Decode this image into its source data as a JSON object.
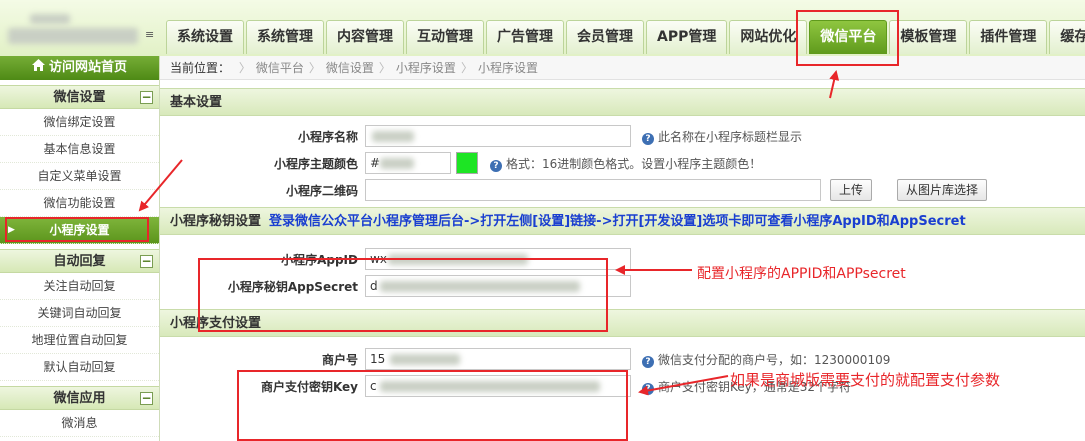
{
  "header": {
    "logo_tail": "≡",
    "tabs": [
      {
        "label": "系统设置",
        "active": false
      },
      {
        "label": "系统管理",
        "active": false
      },
      {
        "label": "内容管理",
        "active": false
      },
      {
        "label": "互动管理",
        "active": false
      },
      {
        "label": "广告管理",
        "active": false
      },
      {
        "label": "会员管理",
        "active": false
      },
      {
        "label": "APP管理",
        "active": false
      },
      {
        "label": "网站优化",
        "active": false
      },
      {
        "label": "微信平台",
        "active": true
      },
      {
        "label": "模板管理",
        "active": false
      },
      {
        "label": "插件管理",
        "active": false
      },
      {
        "label": "缓存",
        "active": false
      }
    ]
  },
  "sidebar": {
    "home": "访问网站首页",
    "groups": [
      {
        "title": "微信设置",
        "toggle": "−",
        "items": [
          "微信绑定设置",
          "基本信息设置",
          "自定义菜单设置",
          "微信功能设置",
          "小程序设置"
        ]
      },
      {
        "title": "自动回复",
        "toggle": "−",
        "items": [
          "关注自动回复",
          "关键词自动回复",
          "地理位置自动回复",
          "默认自动回复"
        ]
      },
      {
        "title": "微信应用",
        "toggle": "−",
        "items": [
          "微消息"
        ]
      }
    ],
    "active_item": "小程序设置"
  },
  "breadcrumb": {
    "label": "当前位置：",
    "items": [
      "微信平台",
      "微信设置",
      "小程序设置",
      "小程序设置"
    ]
  },
  "form": {
    "basic": {
      "title": "基本设置",
      "name_label": "小程序名称",
      "name_hint": "此名称在小程序标题栏显示",
      "color_label": "小程序主题颜色",
      "color_value": "#",
      "color_hint": "格式：16进制颜色格式。设置小程序主题颜色！",
      "qrcode_label": "小程序二维码",
      "upload_btn": "上传",
      "library_btn": "从图片库选择",
      "swatch_color": "#1de524"
    },
    "secret": {
      "title": "小程序秘钥设置",
      "note": "登录微信公众平台小程序管理后台->打开左侧[设置]链接->打开[开发设置]选项卡即可查看小程序AppID和AppSecret",
      "appid_label": "小程序AppID",
      "appid_value": "wx",
      "appsecret_label": "小程序秘钥AppSecret",
      "appsecret_value": "d"
    },
    "pay": {
      "title": "小程序支付设置",
      "mch_label": "商户号",
      "mch_value": "15",
      "mch_hint": "微信支付分配的商户号，如：1230000109",
      "key_label": "商户支付密钥Key",
      "key_value": "c",
      "key_hint": "商户支付密钥Key，通常是32个字符"
    }
  },
  "annotations": {
    "appid_note": "配置小程序的APPID和APPsecret",
    "pay_note": "如果是商城版需要支付的就配置支付参数",
    "color": "#e8262a"
  }
}
